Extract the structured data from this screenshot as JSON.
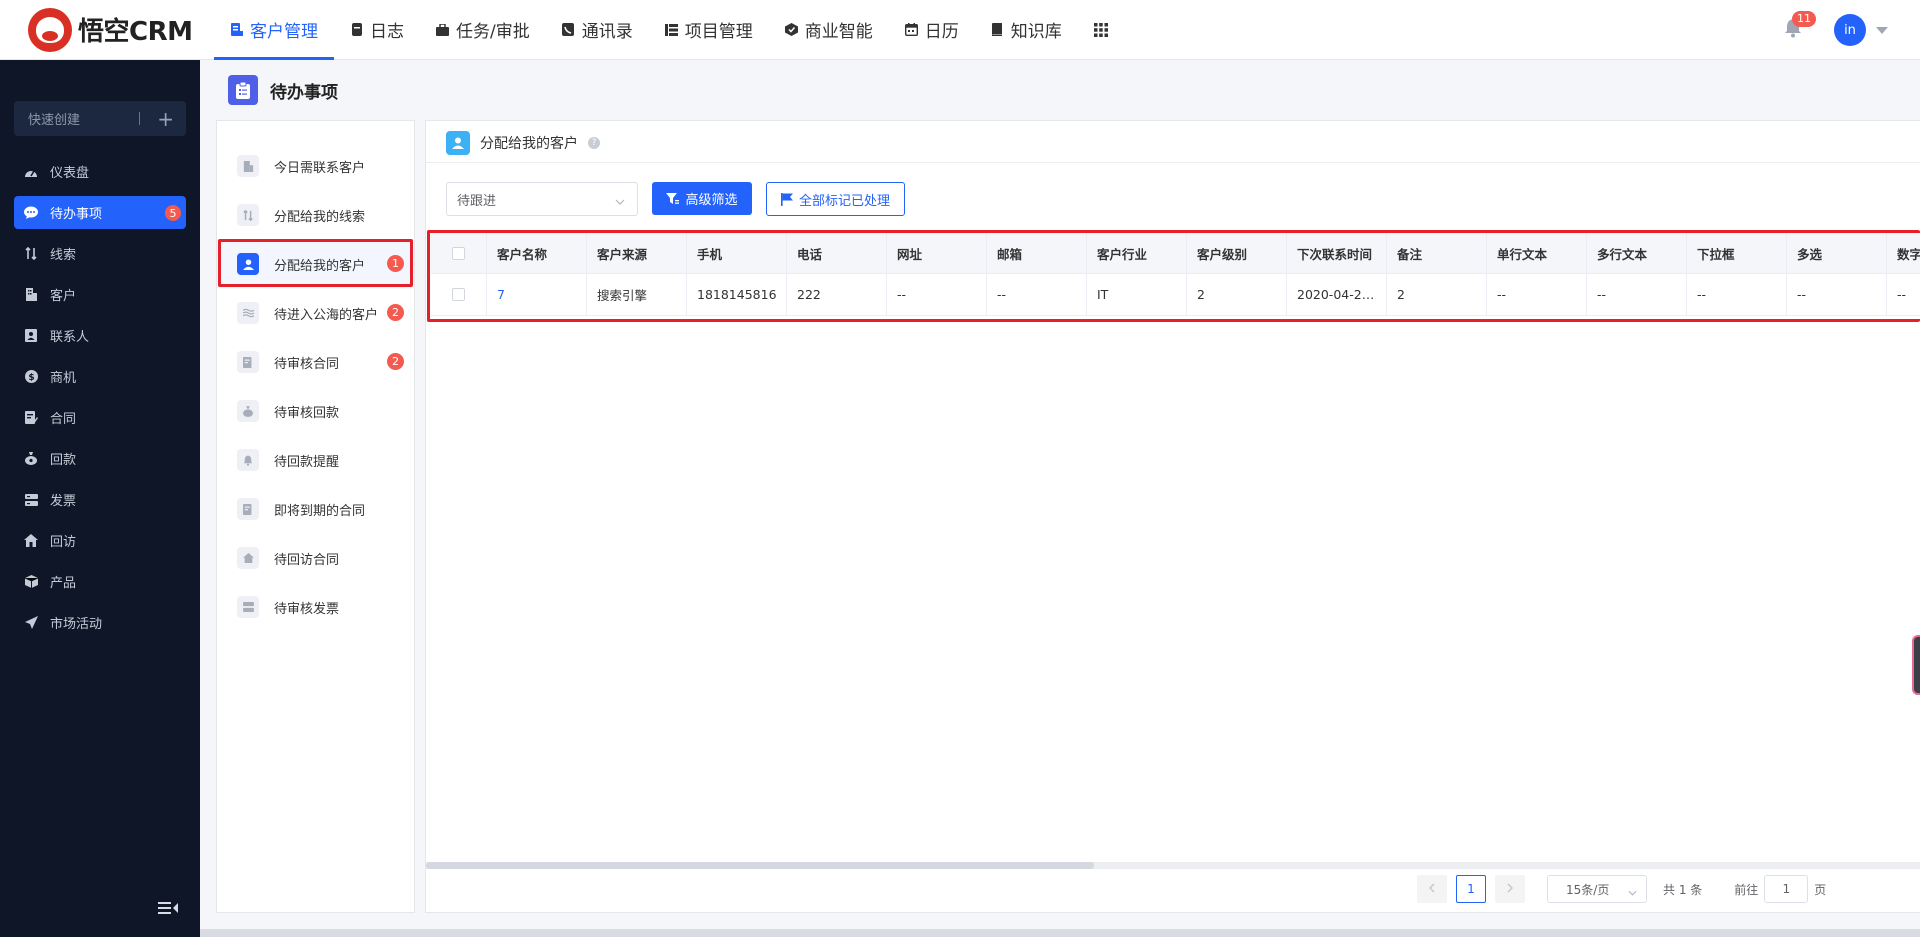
{
  "brand": {
    "name": "悟空CRM"
  },
  "top_nav": {
    "items": [
      {
        "label": "客户管理",
        "icon": "customer-doc-icon",
        "active": true
      },
      {
        "label": "日志",
        "icon": "log-icon"
      },
      {
        "label": "任务/审批",
        "icon": "briefcase-icon"
      },
      {
        "label": "通讯录",
        "icon": "phonebook-icon"
      },
      {
        "label": "项目管理",
        "icon": "project-icon"
      },
      {
        "label": "商业智能",
        "icon": "bi-icon"
      },
      {
        "label": "日历",
        "icon": "calendar-icon"
      },
      {
        "label": "知识库",
        "icon": "book-icon"
      }
    ],
    "notifications_count": "11",
    "user_initials": "in"
  },
  "sidebar": {
    "quick_create": "快速创建",
    "items": [
      {
        "label": "仪表盘",
        "icon": "dashboard-icon"
      },
      {
        "label": "待办事项",
        "icon": "chat-icon",
        "active": true,
        "badge": "5"
      },
      {
        "label": "线索",
        "icon": "lead-icon"
      },
      {
        "label": "客户",
        "icon": "building-icon"
      },
      {
        "label": "联系人",
        "icon": "contact-icon"
      },
      {
        "label": "商机",
        "icon": "dollar-icon"
      },
      {
        "label": "合同",
        "icon": "contract-icon"
      },
      {
        "label": "回款",
        "icon": "money-bag-icon"
      },
      {
        "label": "发票",
        "icon": "invoice-icon"
      },
      {
        "label": "回访",
        "icon": "home-icon"
      },
      {
        "label": "产品",
        "icon": "cube-icon"
      },
      {
        "label": "市场活动",
        "icon": "send-icon"
      }
    ]
  },
  "page": {
    "title": "待办事项"
  },
  "todo_list": [
    {
      "label": "今日需联系客户",
      "icon": "building-icon"
    },
    {
      "label": "分配给我的线索",
      "icon": "lead-icon"
    },
    {
      "label": "分配给我的客户",
      "icon": "user-icon",
      "active": true,
      "badge": "1"
    },
    {
      "label": "待进入公海的客户",
      "icon": "waves-icon",
      "badge": "2"
    },
    {
      "label": "待审核合同",
      "icon": "contract-icon",
      "badge": "2"
    },
    {
      "label": "待审核回款",
      "icon": "money-bag-icon"
    },
    {
      "label": "待回款提醒",
      "icon": "bell-icon"
    },
    {
      "label": "即将到期的合同",
      "icon": "contract-icon"
    },
    {
      "label": "待回访合同",
      "icon": "home-icon"
    },
    {
      "label": "待审核发票",
      "icon": "invoice-icon"
    }
  ],
  "main": {
    "section_title": "分配给我的客户",
    "filter_select": "待跟进",
    "advanced_filter_label": "高级筛选",
    "mark_all_label": "全部标记已处理",
    "table": {
      "columns": [
        "客户名称",
        "客户来源",
        "手机",
        "电话",
        "网址",
        "邮箱",
        "客户行业",
        "客户级别",
        "下次联系时间",
        "备注",
        "单行文本",
        "多行文本",
        "下拉框",
        "多选",
        "数字"
      ],
      "rows": [
        [
          "7",
          "搜索引擎",
          "1818145816",
          "222",
          "--",
          "--",
          "IT",
          "2",
          "2020-04-2…",
          "2",
          "--",
          "--",
          "--",
          "--",
          "--"
        ]
      ]
    },
    "pagination": {
      "current_page": "1",
      "page_size": "15条/页",
      "total": "共 1 条",
      "goto_label": "前往",
      "goto_value": "1",
      "page_suffix": "页"
    }
  },
  "colors": {
    "accent": "#2362fb",
    "sidebar_bg": "#0e1627",
    "badge": "#f45a4f",
    "highlight": "#e5202b"
  }
}
